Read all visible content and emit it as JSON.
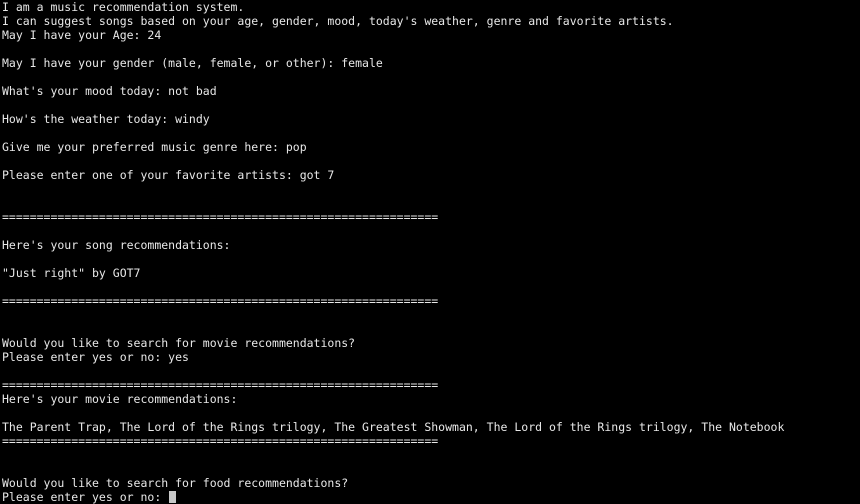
{
  "terminal": {
    "lines": [
      "I am a music recommendation system.",
      "I can suggest songs based on your age, gender, mood, today's weather, genre and favorite artists.",
      "May I have your Age: 24",
      "",
      "May I have your gender (male, female, or other): female",
      "",
      "What's your mood today: not bad",
      "",
      "How's the weather today: windy",
      "",
      "Give me your preferred music genre here: pop",
      "",
      "Please enter one of your favorite artists: got 7",
      "",
      "",
      "===============================================================",
      "",
      "Here's your song recommendations:",
      "",
      "\"Just right\" by GOT7",
      "",
      "===============================================================",
      "",
      "",
      "Would you like to search for movie recommendations?",
      "Please enter yes or no: yes",
      "",
      "===============================================================",
      "Here's your movie recommendations:",
      "",
      "The Parent Trap, The Lord of the Rings trilogy, The Greatest Showman, The Lord of the Rings trilogy, The Notebook",
      "===============================================================",
      "",
      "",
      "Would you like to search for food recommendations?"
    ],
    "prompt": "Please enter yes or no: "
  }
}
